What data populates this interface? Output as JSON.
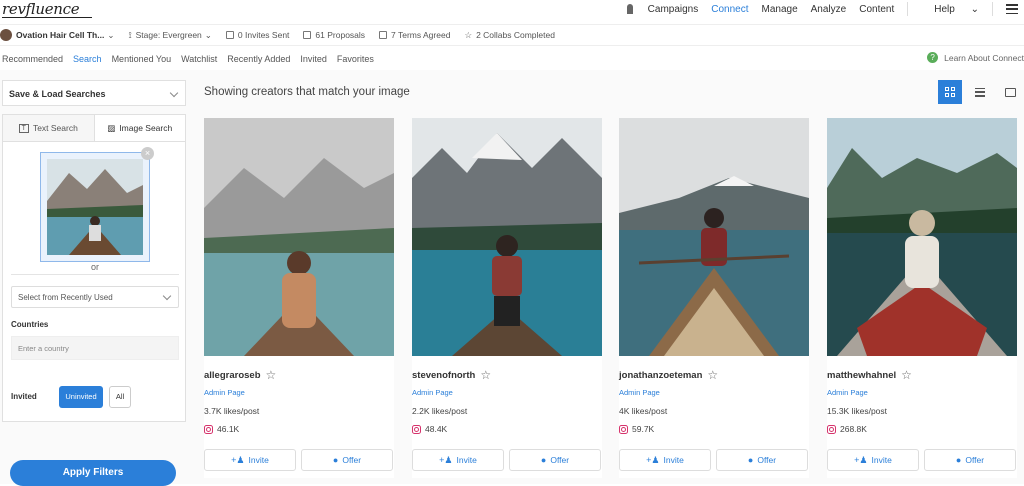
{
  "app": {
    "logo": "revfluence"
  },
  "topnav": {
    "campaigns": "Campaigns",
    "connect": "Connect",
    "manage": "Manage",
    "analyze": "Analyze",
    "content": "Content",
    "help": "Help"
  },
  "campaign": {
    "name": "Ovation Hair Cell Th...",
    "stage": "Stage: Evergreen",
    "invites": "0 Invites Sent",
    "proposals": "61 Proposals",
    "terms": "7 Terms Agreed",
    "collabs": "2 Collabs Completed"
  },
  "tabs": [
    "Recommended",
    "Search",
    "Mentioned You",
    "Watchlist",
    "Recently Added",
    "Invited",
    "Favorites"
  ],
  "learn": "Learn About Connect",
  "sidebar": {
    "save_load": "Save & Load Searches",
    "text_search": "Text Search",
    "image_search": "Image Search",
    "or": "or",
    "recent_placeholder": "Select from Recently Used",
    "countries_label": "Countries",
    "country_placeholder": "Enter a country",
    "invited_label": "Invited",
    "uninvited": "Uninvited",
    "all": "All",
    "apply": "Apply Filters"
  },
  "results_heading": "Showing creators that match your image",
  "creators": [
    {
      "name": "allegraroseb",
      "admin": "Admin Page",
      "likes": "3.7K likes/post",
      "followers": "46.1K"
    },
    {
      "name": "stevenofnorth",
      "admin": "Admin Page",
      "likes": "2.2K likes/post",
      "followers": "48.4K"
    },
    {
      "name": "jonathanzoeteman",
      "admin": "Admin Page",
      "likes": "4K likes/post",
      "followers": "59.7K"
    },
    {
      "name": "matthewhahnel",
      "admin": "Admin Page",
      "likes": "15.3K likes/post",
      "followers": "268.8K"
    }
  ],
  "card_actions": {
    "invite": "Invite",
    "offer": "Offer"
  },
  "colors": {
    "accent": "#2b7fd9",
    "instagram": "#d6336c"
  }
}
